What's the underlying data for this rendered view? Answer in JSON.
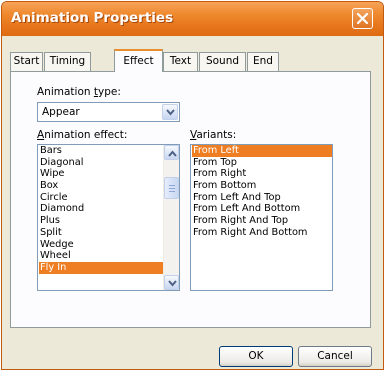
{
  "window": {
    "title": "Animation Properties"
  },
  "tabs": [
    {
      "label": "Start",
      "active": false
    },
    {
      "label": "Timing",
      "active": false
    },
    {
      "label": "Effect",
      "active": true
    },
    {
      "label": "Text",
      "active": false
    },
    {
      "label": "Sound",
      "active": false
    },
    {
      "label": "End",
      "active": false
    }
  ],
  "animation_type": {
    "label_prefix": "Animation ",
    "label_accel": "t",
    "label_suffix": "ype:",
    "value": "Appear"
  },
  "animation_effect": {
    "label_accel": "A",
    "label_suffix": "nimation effect:",
    "items": [
      "Bars",
      "Diagonal",
      "Wipe",
      "Box",
      "Circle",
      "Diamond",
      "Plus",
      "Split",
      "Wedge",
      "Wheel",
      "Fly In"
    ],
    "selected": "Fly In"
  },
  "variants": {
    "label_accel": "V",
    "label_suffix": "ariants:",
    "items": [
      "From Left",
      "From Top",
      "From Right",
      "From Bottom",
      "From Left And Top",
      "From Left And Bottom",
      "From Right And Top",
      "From Right And Bottom"
    ],
    "selected": "From Left"
  },
  "buttons": {
    "ok": "OK",
    "cancel": "Cancel"
  },
  "colors": {
    "titlebar": "#e7761c",
    "selection": "#ef7d22",
    "dialog": "#ece9d8"
  }
}
